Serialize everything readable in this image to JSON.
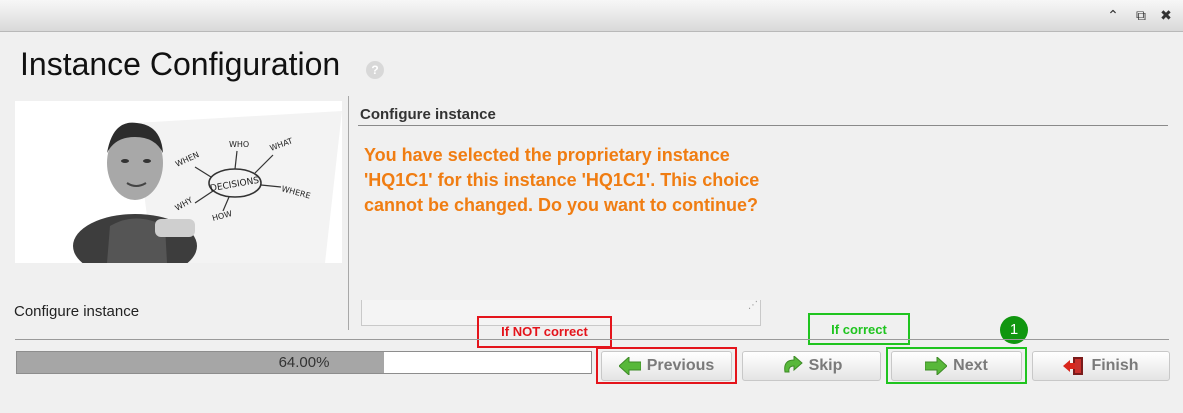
{
  "window": {
    "controls": [
      {
        "name": "collapse-icon",
        "glyph": "⌃"
      },
      {
        "name": "popout-icon",
        "glyph": "⧉"
      },
      {
        "name": "close-icon",
        "glyph": "✖"
      }
    ]
  },
  "page": {
    "title": "Instance Configuration",
    "help_glyph": "?"
  },
  "left_panel": {
    "image_words": [
      "WHO",
      "WHAT",
      "WHEN",
      "DECISIONS",
      "WHERE",
      "WHY",
      "HOW"
    ],
    "step_label": "Configure instance"
  },
  "right_panel": {
    "section_title": "Configure instance",
    "message": "You have selected the proprietary instance 'HQ1C1' for this instance 'HQ1C1'. This choice cannot be changed. Do you want to continue?"
  },
  "progress": {
    "value": 64.0,
    "label": "64.00%"
  },
  "buttons": {
    "previous": "Previous",
    "skip": "Skip",
    "next": "Next",
    "finish": "Finish"
  },
  "annotations": {
    "not_correct": "If NOT correct",
    "correct": "If correct",
    "step_badge": "1"
  },
  "colors": {
    "message": "#f07d12",
    "callout_red": "#e4141b",
    "callout_green": "#1fc41f",
    "badge_green": "#10960f",
    "arrow_green": "#58b83a"
  }
}
